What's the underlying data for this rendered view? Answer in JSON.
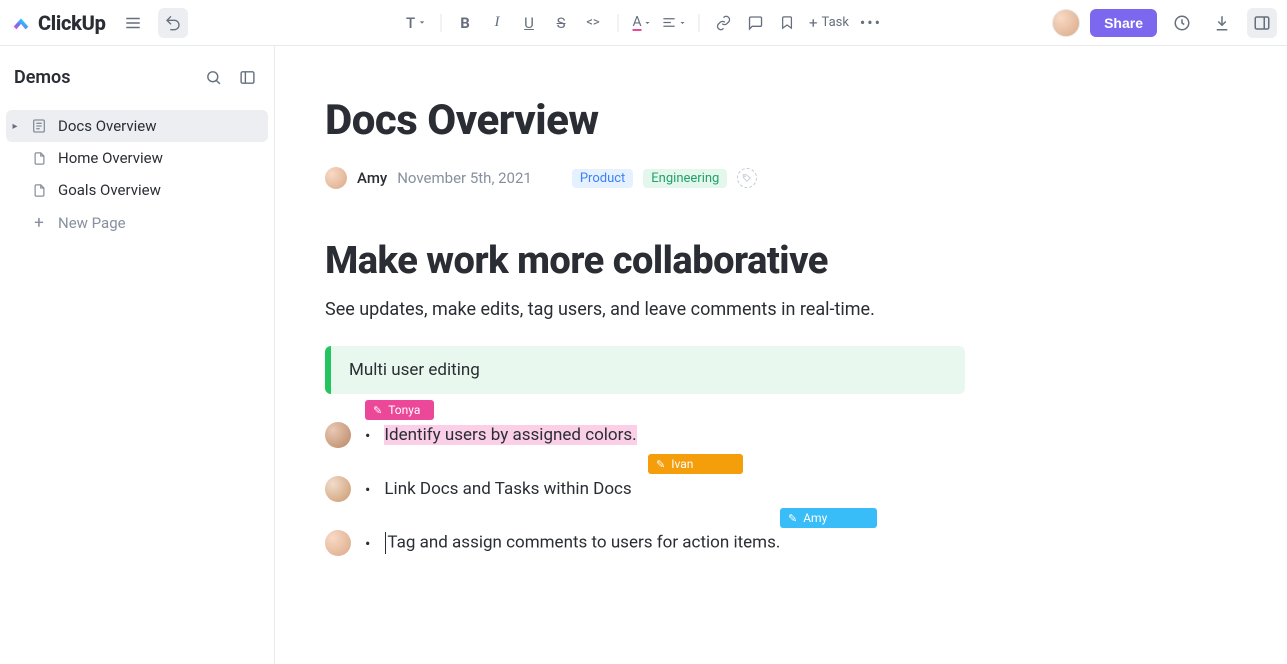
{
  "app": {
    "name": "ClickUp"
  },
  "toolbar": {
    "text_style": "T",
    "task_label": "Task"
  },
  "topbar_right": {
    "share_label": "Share"
  },
  "sidebar": {
    "title": "Demos",
    "items": [
      {
        "label": "Docs Overview",
        "active": true
      },
      {
        "label": "Home Overview",
        "active": false
      },
      {
        "label": "Goals Overview",
        "active": false
      }
    ],
    "new_page_label": "New Page"
  },
  "doc": {
    "title": "Docs Overview",
    "author": "Amy",
    "date": "November 5th, 2021",
    "tags": {
      "product": "Product",
      "engineering": "Engineering"
    },
    "heading": "Make work more collaborative",
    "subtext": "See updates, make edits, tag users, and leave comments in real-time.",
    "callout": "Multi user editing",
    "bullets": [
      "Identify users by assigned colors.",
      "Link Docs and Tasks within Docs",
      "Tag and assign comments to users for action items."
    ],
    "presence": {
      "tonya": "Tonya",
      "ivan": "Ivan",
      "amy": "Amy"
    }
  }
}
